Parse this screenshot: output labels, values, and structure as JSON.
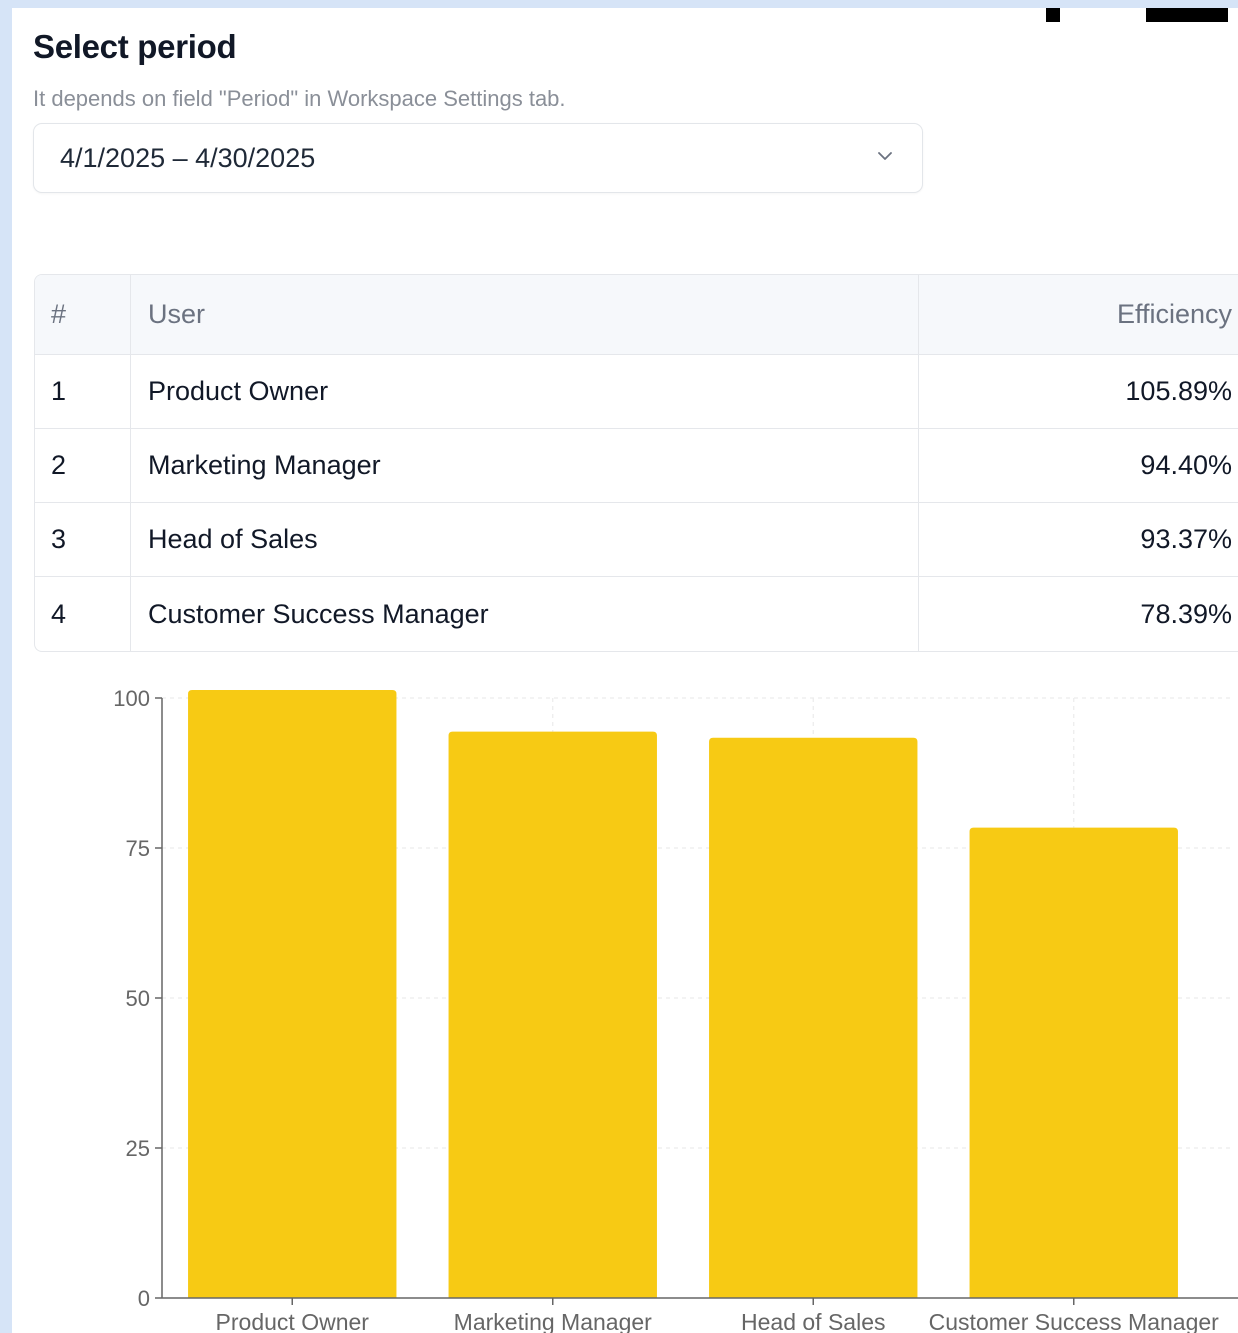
{
  "header": {
    "title": "Select period",
    "subtitle": "It depends on field \"Period\" in Workspace Settings tab."
  },
  "period_select": {
    "value": "4/1/2025 – 4/30/2025",
    "icon": "chevron-down-icon"
  },
  "table": {
    "columns": [
      "#",
      "User",
      "Efficiency"
    ],
    "rows": [
      {
        "idx": "1",
        "user": "Product Owner",
        "efficiency": "105.89%"
      },
      {
        "idx": "2",
        "user": "Marketing Manager",
        "efficiency": "94.40%"
      },
      {
        "idx": "3",
        "user": "Head of Sales",
        "efficiency": "93.37%"
      },
      {
        "idx": "4",
        "user": "Customer Success Manager",
        "efficiency": "78.39%"
      }
    ]
  },
  "colors": {
    "bar": "#f7ca14",
    "axis": "#666666",
    "grid": "#ececec"
  },
  "chart_data": {
    "type": "bar",
    "categories": [
      "Product Owner",
      "Marketing Manager",
      "Head of Sales",
      "Customer Success Manager"
    ],
    "values": [
      105.89,
      94.4,
      93.37,
      78.39
    ],
    "ylim": [
      0,
      100
    ],
    "yticks": [
      0,
      25,
      50,
      75,
      100
    ],
    "title": "",
    "xlabel": "",
    "ylabel": "",
    "grid": true,
    "legend": "none"
  }
}
